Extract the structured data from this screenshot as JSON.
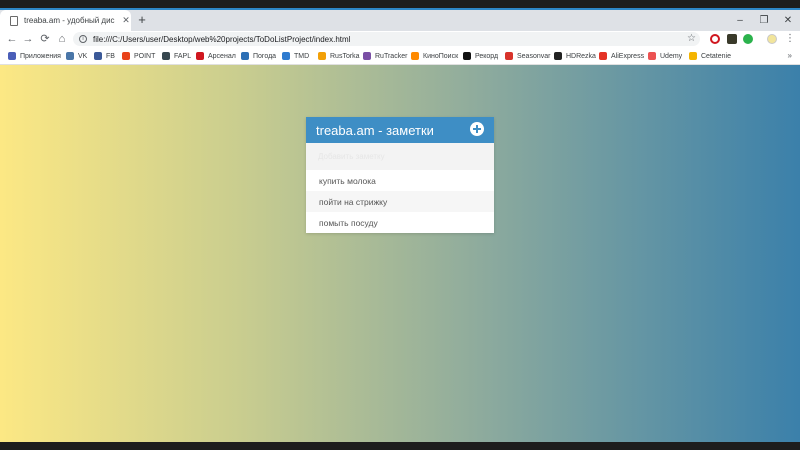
{
  "browser": {
    "tab": {
      "title": "treaba.am - удобный диспетчер",
      "close_glyph": "✕",
      "favicon": "page-icon"
    },
    "new_tab_glyph": "+",
    "window_controls": {
      "minimize": "–",
      "maximize": "❐",
      "close": "✕"
    },
    "nav": {
      "back": "←",
      "forward": "→",
      "reload": "⟳",
      "home": "⌂"
    },
    "address_bar": {
      "url": "file:///C:/Users/user/Desktop/web%20projects/ToDoListProject/index.html",
      "info_glyph": "i",
      "star_glyph": "☆"
    },
    "menu_glyph": "⋮",
    "bookmarks": [
      {
        "label": "Приложения",
        "color": "#4a5eb8"
      },
      {
        "label": "VK",
        "color": "#4a76a8"
      },
      {
        "label": "FB",
        "color": "#3b5998"
      },
      {
        "label": "POINT",
        "color": "#e8421a"
      },
      {
        "label": "FAPL",
        "color": "#37474f"
      },
      {
        "label": "Арсенал",
        "color": "#d0171f"
      },
      {
        "label": "Погода",
        "color": "#2c6fb5"
      },
      {
        "label": "TMD",
        "color": "#2e7bcf"
      },
      {
        "label": "RusTorka",
        "color": "#f2a007"
      },
      {
        "label": "RuTracker",
        "color": "#7a4fa5"
      },
      {
        "label": "КиноПоиск",
        "color": "#ff8a00"
      },
      {
        "label": "Рекорд",
        "color": "#111111"
      },
      {
        "label": "Seasonvar",
        "color": "#d8332b"
      },
      {
        "label": "HDRezka",
        "color": "#222222"
      },
      {
        "label": "AliExpress",
        "color": "#e43225"
      },
      {
        "label": "Udemy",
        "color": "#ec5252"
      },
      {
        "label": "Cetatenie",
        "color": "#f4b400"
      }
    ],
    "bookmarks_more": "»"
  },
  "app": {
    "title": "treaba.am - заметки",
    "input_placeholder": "Добавить заметку",
    "items": [
      {
        "label": "купить молока"
      },
      {
        "label": "пойти на стрижку"
      },
      {
        "label": "помыть посуду"
      }
    ]
  }
}
